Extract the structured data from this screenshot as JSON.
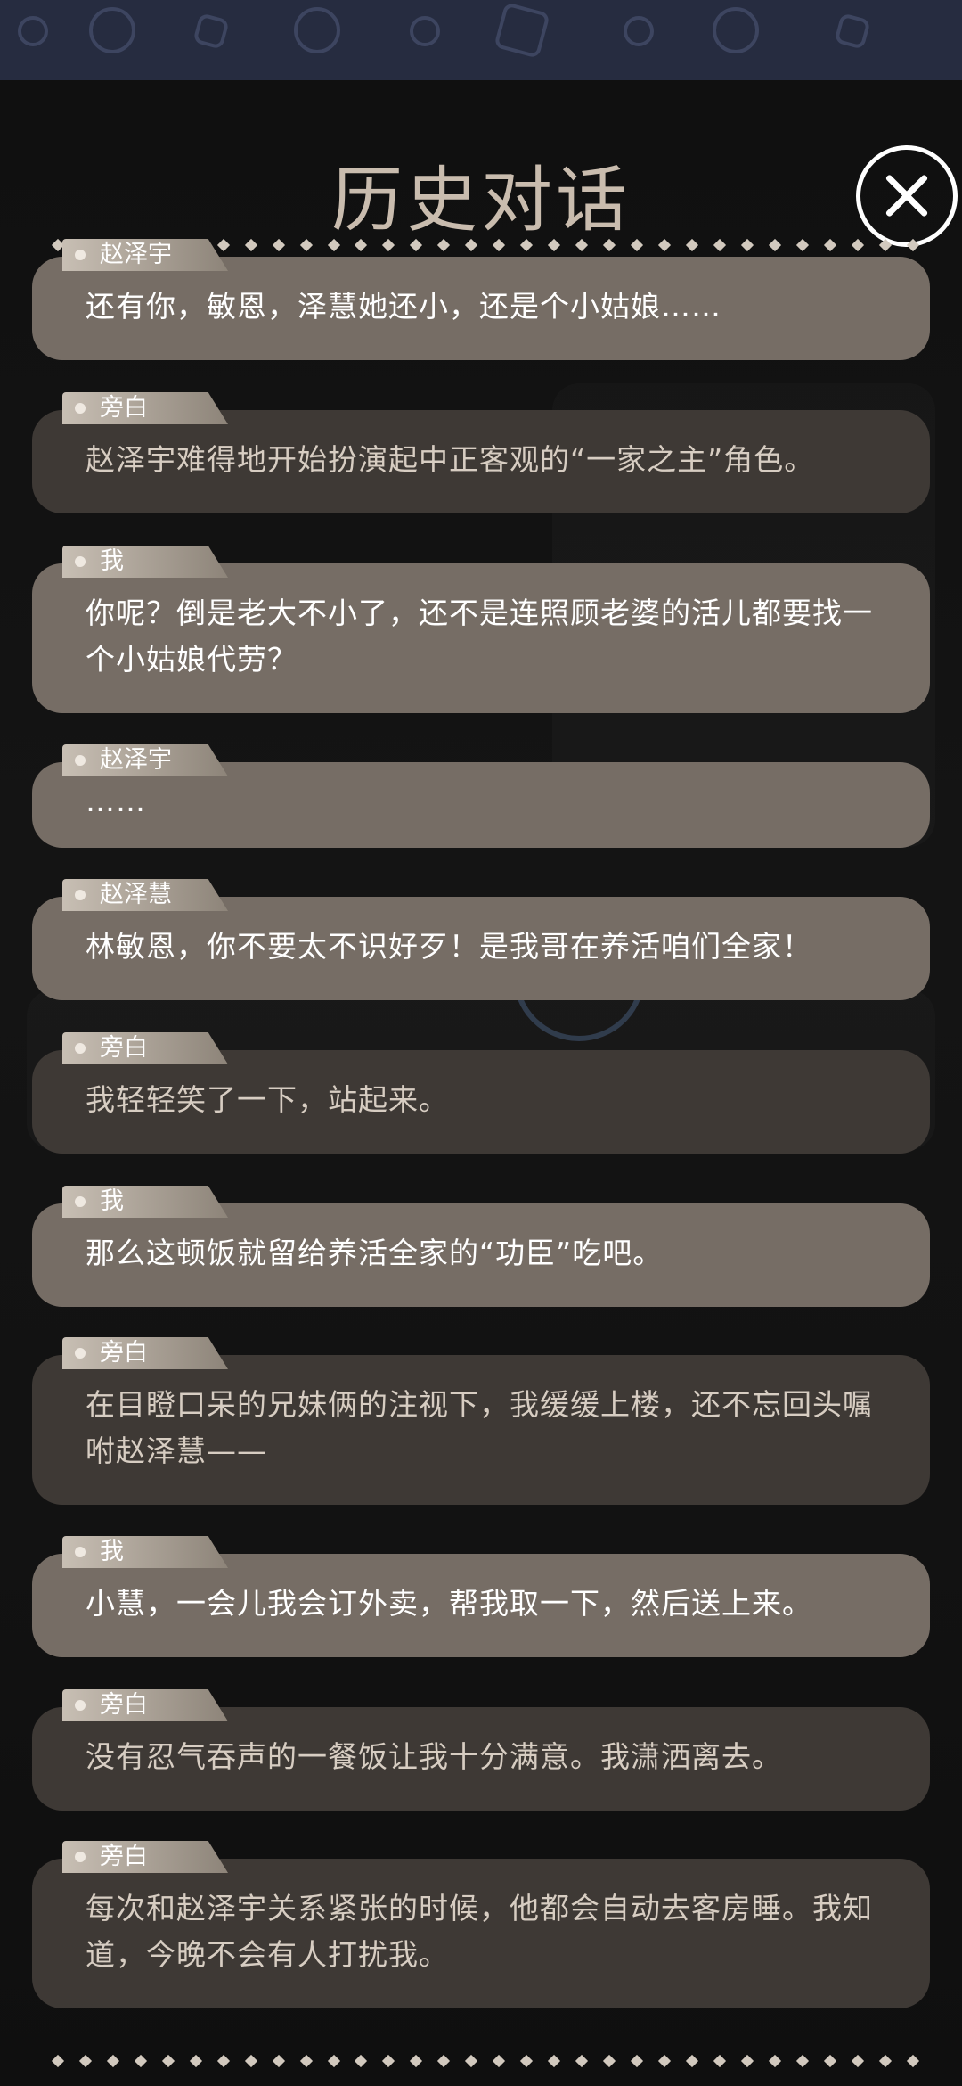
{
  "header": {
    "title": "历史对话",
    "close_icon": "close-icon"
  },
  "entries": [
    {
      "speaker": "赵泽宇",
      "type": "dialogue",
      "text": "还有你，敏恩，泽慧她还小，还是个小姑娘……"
    },
    {
      "speaker": "旁白",
      "type": "narration",
      "text": "赵泽宇难得地开始扮演起中正客观的“一家之主”角色。"
    },
    {
      "speaker": "我",
      "type": "dialogue",
      "text": "你呢？倒是老大不小了，还不是连照顾老婆的活儿都要找一个小姑娘代劳？"
    },
    {
      "speaker": "赵泽宇",
      "type": "dialogue",
      "text": "……"
    },
    {
      "speaker": "赵泽慧",
      "type": "dialogue",
      "text": "林敏恩，你不要太不识好歹！是我哥在养活咱们全家！"
    },
    {
      "speaker": "旁白",
      "type": "narration",
      "text": "我轻轻笑了一下，站起来。"
    },
    {
      "speaker": "我",
      "type": "dialogue",
      "text": "那么这顿饭就留给养活全家的“功臣”吃吧。"
    },
    {
      "speaker": "旁白",
      "type": "narration",
      "text": "在目瞪口呆的兄妹俩的注视下，我缓缓上楼，还不忘回头嘱咐赵泽慧——"
    },
    {
      "speaker": "我",
      "type": "dialogue",
      "text": "小慧，一会儿我会订外卖，帮我取一下，然后送上来。"
    },
    {
      "speaker": "旁白",
      "type": "narration",
      "text": "没有忍气吞声的一餐饭让我十分满意。我潇洒离去。"
    },
    {
      "speaker": "旁白",
      "type": "narration",
      "text": "每次和赵泽宇关系紧张的时候，他都会自动去客房睡。我知道，今晚不会有人打扰我。"
    }
  ],
  "colors": {
    "dialogue_bubble": "#766d65",
    "narration_bubble": "#3e3935",
    "title": "#c9bcae",
    "top_strip": "#262c40"
  }
}
